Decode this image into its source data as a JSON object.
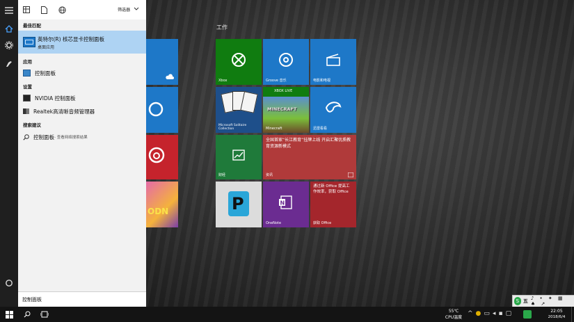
{
  "rail": {
    "icons": [
      "hamburger-menu-icon",
      "home-icon",
      "gear-icon",
      "user-icon",
      "cortana-icon"
    ]
  },
  "panel": {
    "toolbar": {
      "filter_label": "筛选器"
    },
    "best_match": {
      "heading": "最佳匹配",
      "title": "英特尔(R) 核芯显卡控制面板",
      "subtitle": "桌面应用"
    },
    "apps": {
      "heading": "应用",
      "items": [
        {
          "label": "控制面板"
        }
      ]
    },
    "settings": {
      "heading": "设置",
      "items": [
        {
          "label": "NVIDIA 控制面板"
        },
        {
          "label": "Realtek高清晰音频管理器"
        }
      ]
    },
    "suggestions": {
      "heading": "搜索建议",
      "items": [
        {
          "label": "控制面板",
          "hint": " - 查看网络搜索结果"
        }
      ]
    },
    "search": {
      "value": "控制面板"
    }
  },
  "start": {
    "group_label": "工作",
    "tiles": {
      "xbox": "Xbox",
      "groove": "Groove 音乐",
      "movies": "电影和电视",
      "solitaire": "Microsoft Solitaire Collection",
      "minecraft": "Minecraft",
      "xbox_badge": "XBOX LIVE",
      "lark": "迅雷看看",
      "money": "财经",
      "news_line1": "全国首家",
      "news_line2": "创新服务",
      "news_label": "资讯",
      "news_headline": "全国首家“长江教育”挂牌上线 开启汇聚优质教育资源新模式",
      "office_label": "获取 Office",
      "office_promo": "通过新 Office 提高工作效率，获取 Office",
      "office_footer": "获取 Office",
      "onenote": "OneNote",
      "picsart": "PicsArt"
    }
  },
  "taskbar": {
    "cpu_temp": "55℃",
    "cpu_label": "CPU温度",
    "time": "22:05",
    "date": "2018/6/4",
    "ime_label": "五"
  },
  "colors": {
    "accent": "#1e78c8",
    "selection": "#aed3f3",
    "xbox_green": "#107c10",
    "red_tile": "#a4262c",
    "purple_tile": "#6b2c91"
  }
}
